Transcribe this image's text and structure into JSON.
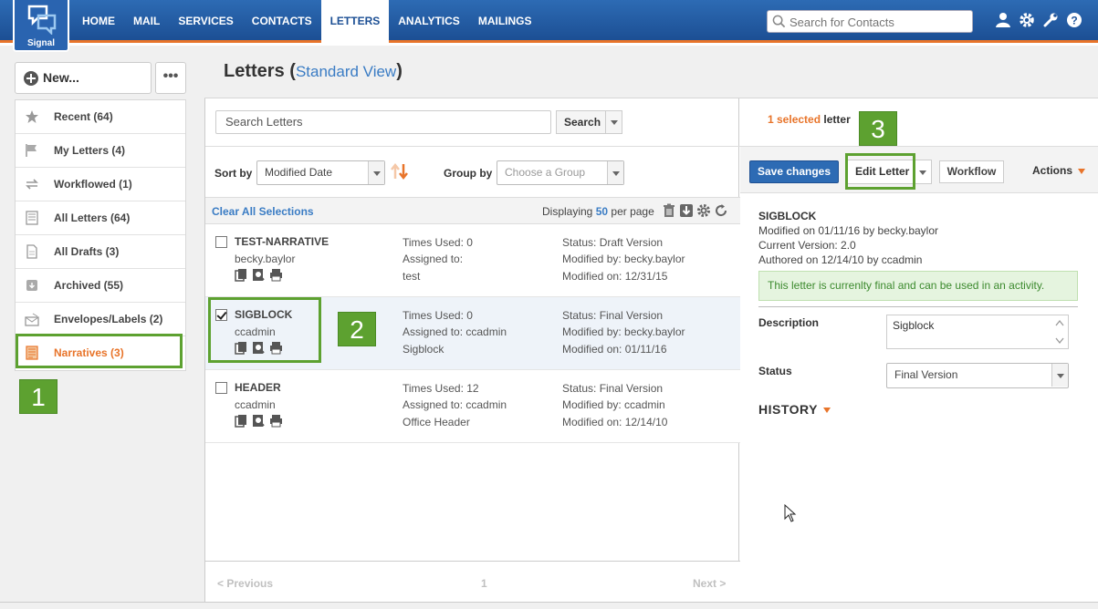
{
  "app": {
    "logo_text": "Signal"
  },
  "nav": {
    "items": [
      "HOME",
      "MAIL",
      "SERVICES",
      "CONTACTS",
      "LETTERS",
      "ANALYTICS",
      "MAILINGS"
    ],
    "active": "LETTERS"
  },
  "top_search": {
    "placeholder": "Search for Contacts"
  },
  "left": {
    "new_label": "New...",
    "more_label": "•••",
    "folders": [
      {
        "label": "Recent (64)",
        "icon": "star-icon"
      },
      {
        "label": "My Letters (4)",
        "icon": "flag-icon"
      },
      {
        "label": "Workflowed (1)",
        "icon": "workflow-icon"
      },
      {
        "label": "All Letters (64)",
        "icon": "document-icon"
      },
      {
        "label": "All Drafts (3)",
        "icon": "draft-icon"
      },
      {
        "label": "Archived (55)",
        "icon": "archive-icon"
      },
      {
        "label": "Envelopes/Labels (2)",
        "icon": "envelope-icon"
      },
      {
        "label": "Narratives (3)",
        "icon": "narrative-icon"
      }
    ],
    "selected_folder": "Narratives (3)"
  },
  "header": {
    "title": "Letters",
    "open_paren": "(",
    "view_label": "Standard View",
    "close_paren": ")"
  },
  "list": {
    "search_placeholder": "Search Letters",
    "search_button": "Search",
    "sort_label": "Sort by",
    "sort_value": "Modified Date",
    "group_label": "Group by",
    "group_value": "Choose a Group",
    "clear_selections": "Clear All Selections",
    "displaying_prefix": "Displaying",
    "per_page": "50",
    "displaying_suffix": "per page",
    "rows": [
      {
        "name": "TEST-NARRATIVE",
        "owner": "becky.baylor",
        "checked": false,
        "times_used": "Times Used: 0",
        "assigned_to": "Assigned to:",
        "desc": "test",
        "status": "Status: Draft Version",
        "modified_by": "Modified by: becky.baylor",
        "modified_on": "Modified on: 12/31/15"
      },
      {
        "name": "SIGBLOCK",
        "owner": "ccadmin",
        "checked": true,
        "times_used": "Times Used: 0",
        "assigned_to": "Assigned to: ccadmin",
        "desc": "Sigblock",
        "status": "Status: Final Version",
        "modified_by": "Modified by: becky.baylor",
        "modified_on": "Modified on: 01/11/16"
      },
      {
        "name": "HEADER",
        "owner": "ccadmin",
        "checked": false,
        "times_used": "Times Used: 12",
        "assigned_to": "Assigned to: ccadmin",
        "desc": "Office Header",
        "status": "Status: Final Version",
        "modified_by": "Modified by: ccadmin",
        "modified_on": "Modified on: 12/14/10"
      }
    ],
    "pager": {
      "previous": "< Previous",
      "page": "1",
      "next": "Next >"
    }
  },
  "detail": {
    "selected_count": "1 selected",
    "selected_suffix": "letter",
    "save_changes": "Save changes",
    "edit_letter": "Edit Letter",
    "workflow": "Workflow",
    "actions": "Actions",
    "title": "SIGBLOCK",
    "modified_line": "Modified on 01/11/16 by becky.baylor",
    "version_line": "Current Version: 2.0",
    "authored_line": "Authored on 12/14/10 by ccadmin",
    "notice": "This letter is currenlty final and can be used in an activity.",
    "description_label": "Description",
    "description_value": "Sigblock",
    "status_label": "Status",
    "status_value": "Final Version",
    "history_label": "HISTORY"
  },
  "callouts": [
    "1",
    "2",
    "3"
  ],
  "colors": {
    "accent_orange": "#e8742a",
    "nav_blue": "#1c4f94",
    "highlight_green": "#5da130"
  }
}
